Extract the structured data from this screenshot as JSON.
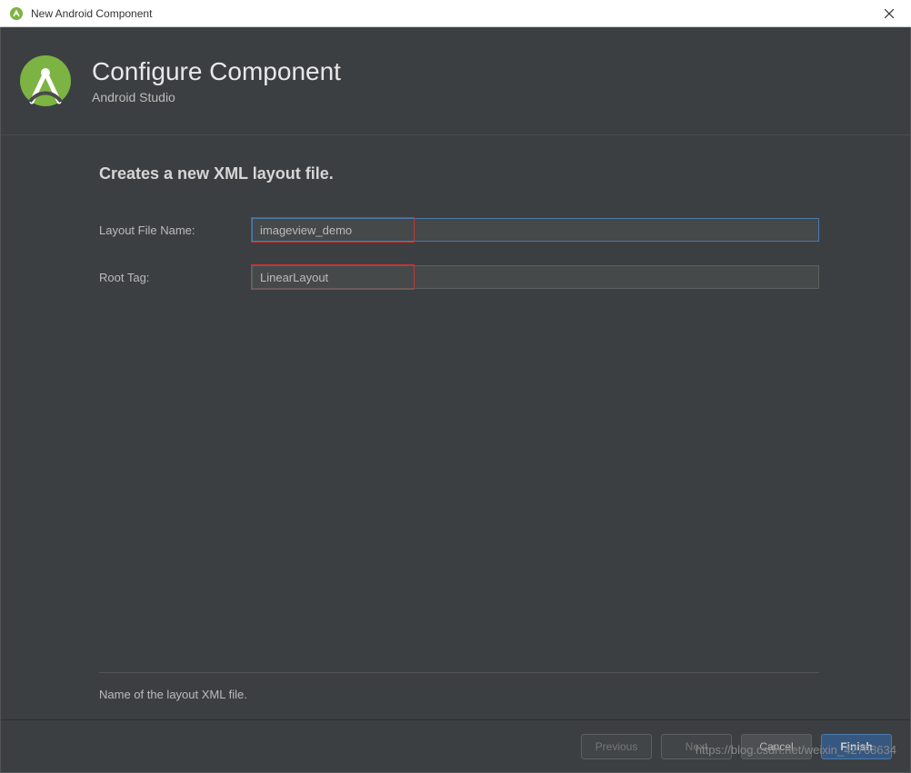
{
  "window": {
    "title": "New Android Component"
  },
  "header": {
    "title": "Configure Component",
    "subtitle": "Android Studio"
  },
  "main": {
    "section_title": "Creates a new XML layout file.",
    "fields": {
      "layout_file_name": {
        "label": "Layout File Name:",
        "value": "imageview_demo"
      },
      "root_tag": {
        "label": "Root Tag:",
        "value": "LinearLayout"
      }
    },
    "hint": "Name of the layout XML file."
  },
  "buttons": {
    "previous": "Previous",
    "next": "Next",
    "cancel": "Cancel",
    "finish": "Finish"
  },
  "watermark": "https://blog.csdn.net/weixin_42768634"
}
